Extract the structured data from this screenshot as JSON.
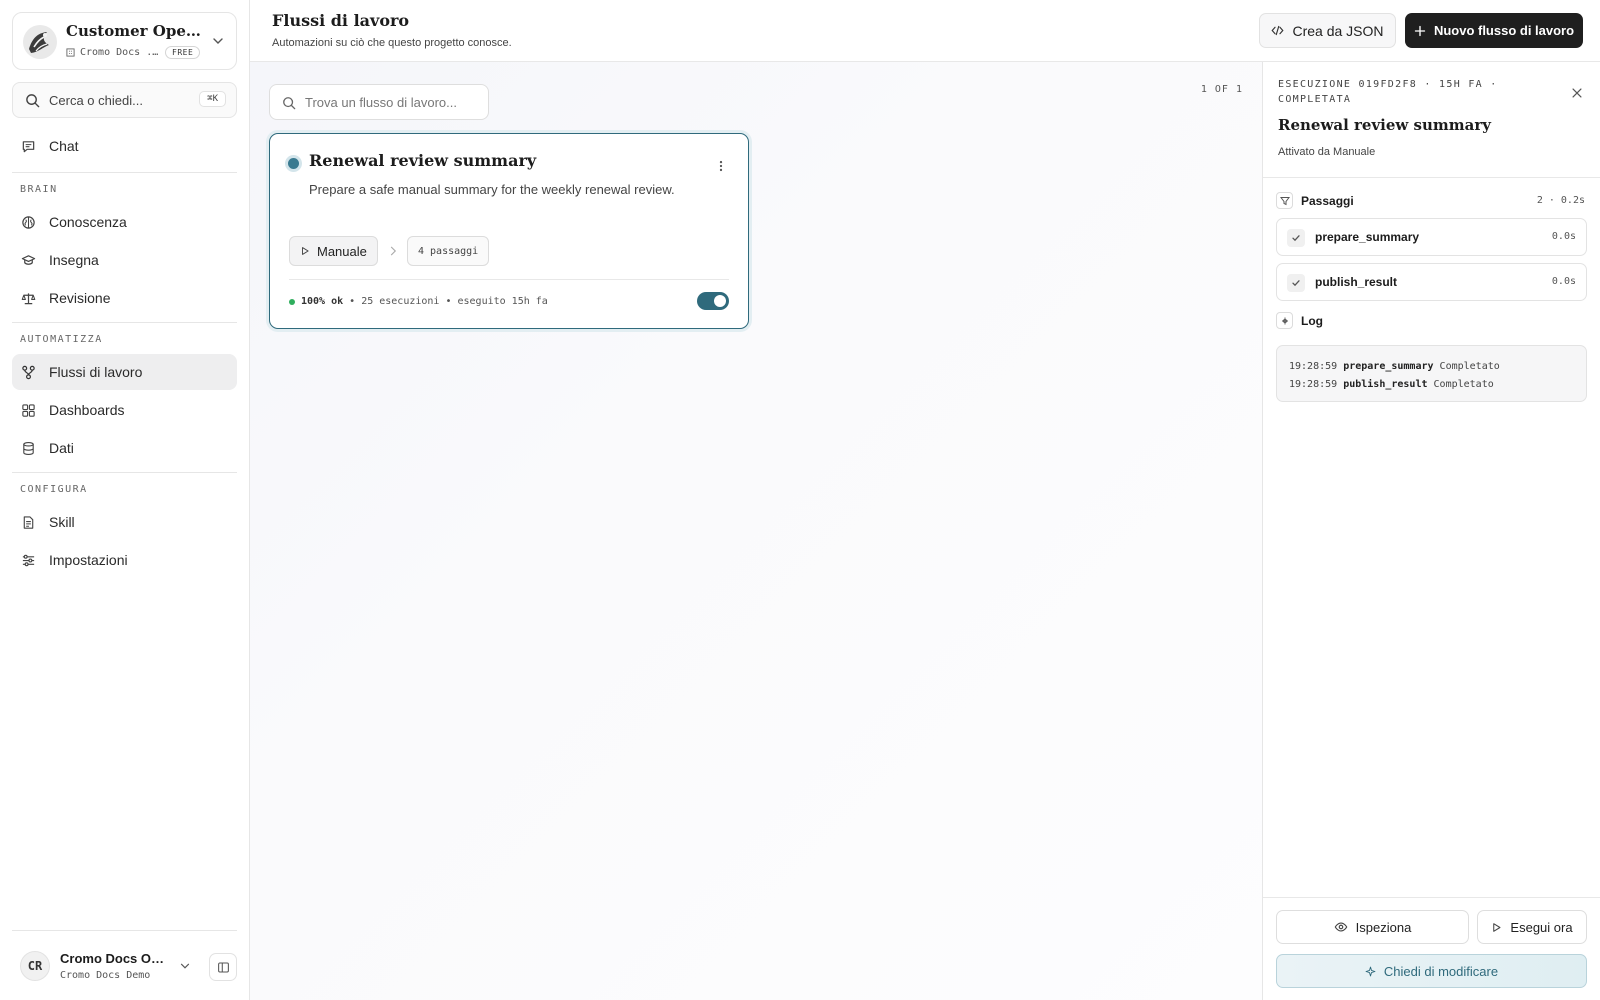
{
  "workspace": {
    "name": "Customer Operati...",
    "org": "Cromo Docs ...",
    "plan": "FREE"
  },
  "search": {
    "placeholder": "Cerca o chiedi...",
    "shortcut": "⌘K"
  },
  "nav": {
    "chat": "Chat",
    "sections": [
      {
        "label": "BRAIN",
        "items": [
          "Conoscenza",
          "Insegna",
          "Revisione"
        ]
      },
      {
        "label": "AUTOMATIZZA",
        "items": [
          "Flussi di lavoro",
          "Dashboards",
          "Dati"
        ]
      },
      {
        "label": "CONFIGURA",
        "items": [
          "Skill",
          "Impostazioni"
        ]
      }
    ],
    "active": "Flussi di lavoro"
  },
  "user": {
    "initials": "CR",
    "name": "Cromo Docs Own...",
    "org": "Cromo Docs Demo"
  },
  "header": {
    "title": "Flussi di lavoro",
    "subtitle": "Automazioni su ciò che questo progetto conosce.",
    "json_button": "Crea da JSON",
    "new_button": "Nuovo flusso di lavoro"
  },
  "list": {
    "search_placeholder": "Trova un flusso di lavoro...",
    "count": "1 OF 1",
    "workflow": {
      "title": "Renewal review summary",
      "description": "Prepare a safe manual summary for the weekly renewal review.",
      "trigger": "Manuale",
      "steps": "4 passaggi",
      "success": "100% ok",
      "runs": "25 esecuzioni",
      "last_run": "eseguito 15h fa",
      "enabled": true
    }
  },
  "panel": {
    "run_meta": "ESECUZIONE 019FD2F8 · 15H FA · COMPLETATA",
    "title": "Renewal review summary",
    "trigger": "Attivato da Manuale",
    "steps_label": "Passaggi",
    "steps_count": "2 · 0.2s",
    "steps": [
      {
        "name": "prepare_summary",
        "time": "0.0s"
      },
      {
        "name": "publish_result",
        "time": "0.0s"
      }
    ],
    "log_label": "Log",
    "logs": [
      {
        "time": "19:28:59",
        "step": "prepare_summary",
        "status": "Completato"
      },
      {
        "time": "19:28:59",
        "step": "publish_result",
        "status": "Completato"
      }
    ],
    "inspect_button": "Ispeziona",
    "run_button": "Esegui ora",
    "ask_button": "Chiedi di modificare"
  },
  "colors": {
    "accent": "#2f6a7c",
    "success": "#2fae5d",
    "primary_button": "#1f1f1f"
  }
}
